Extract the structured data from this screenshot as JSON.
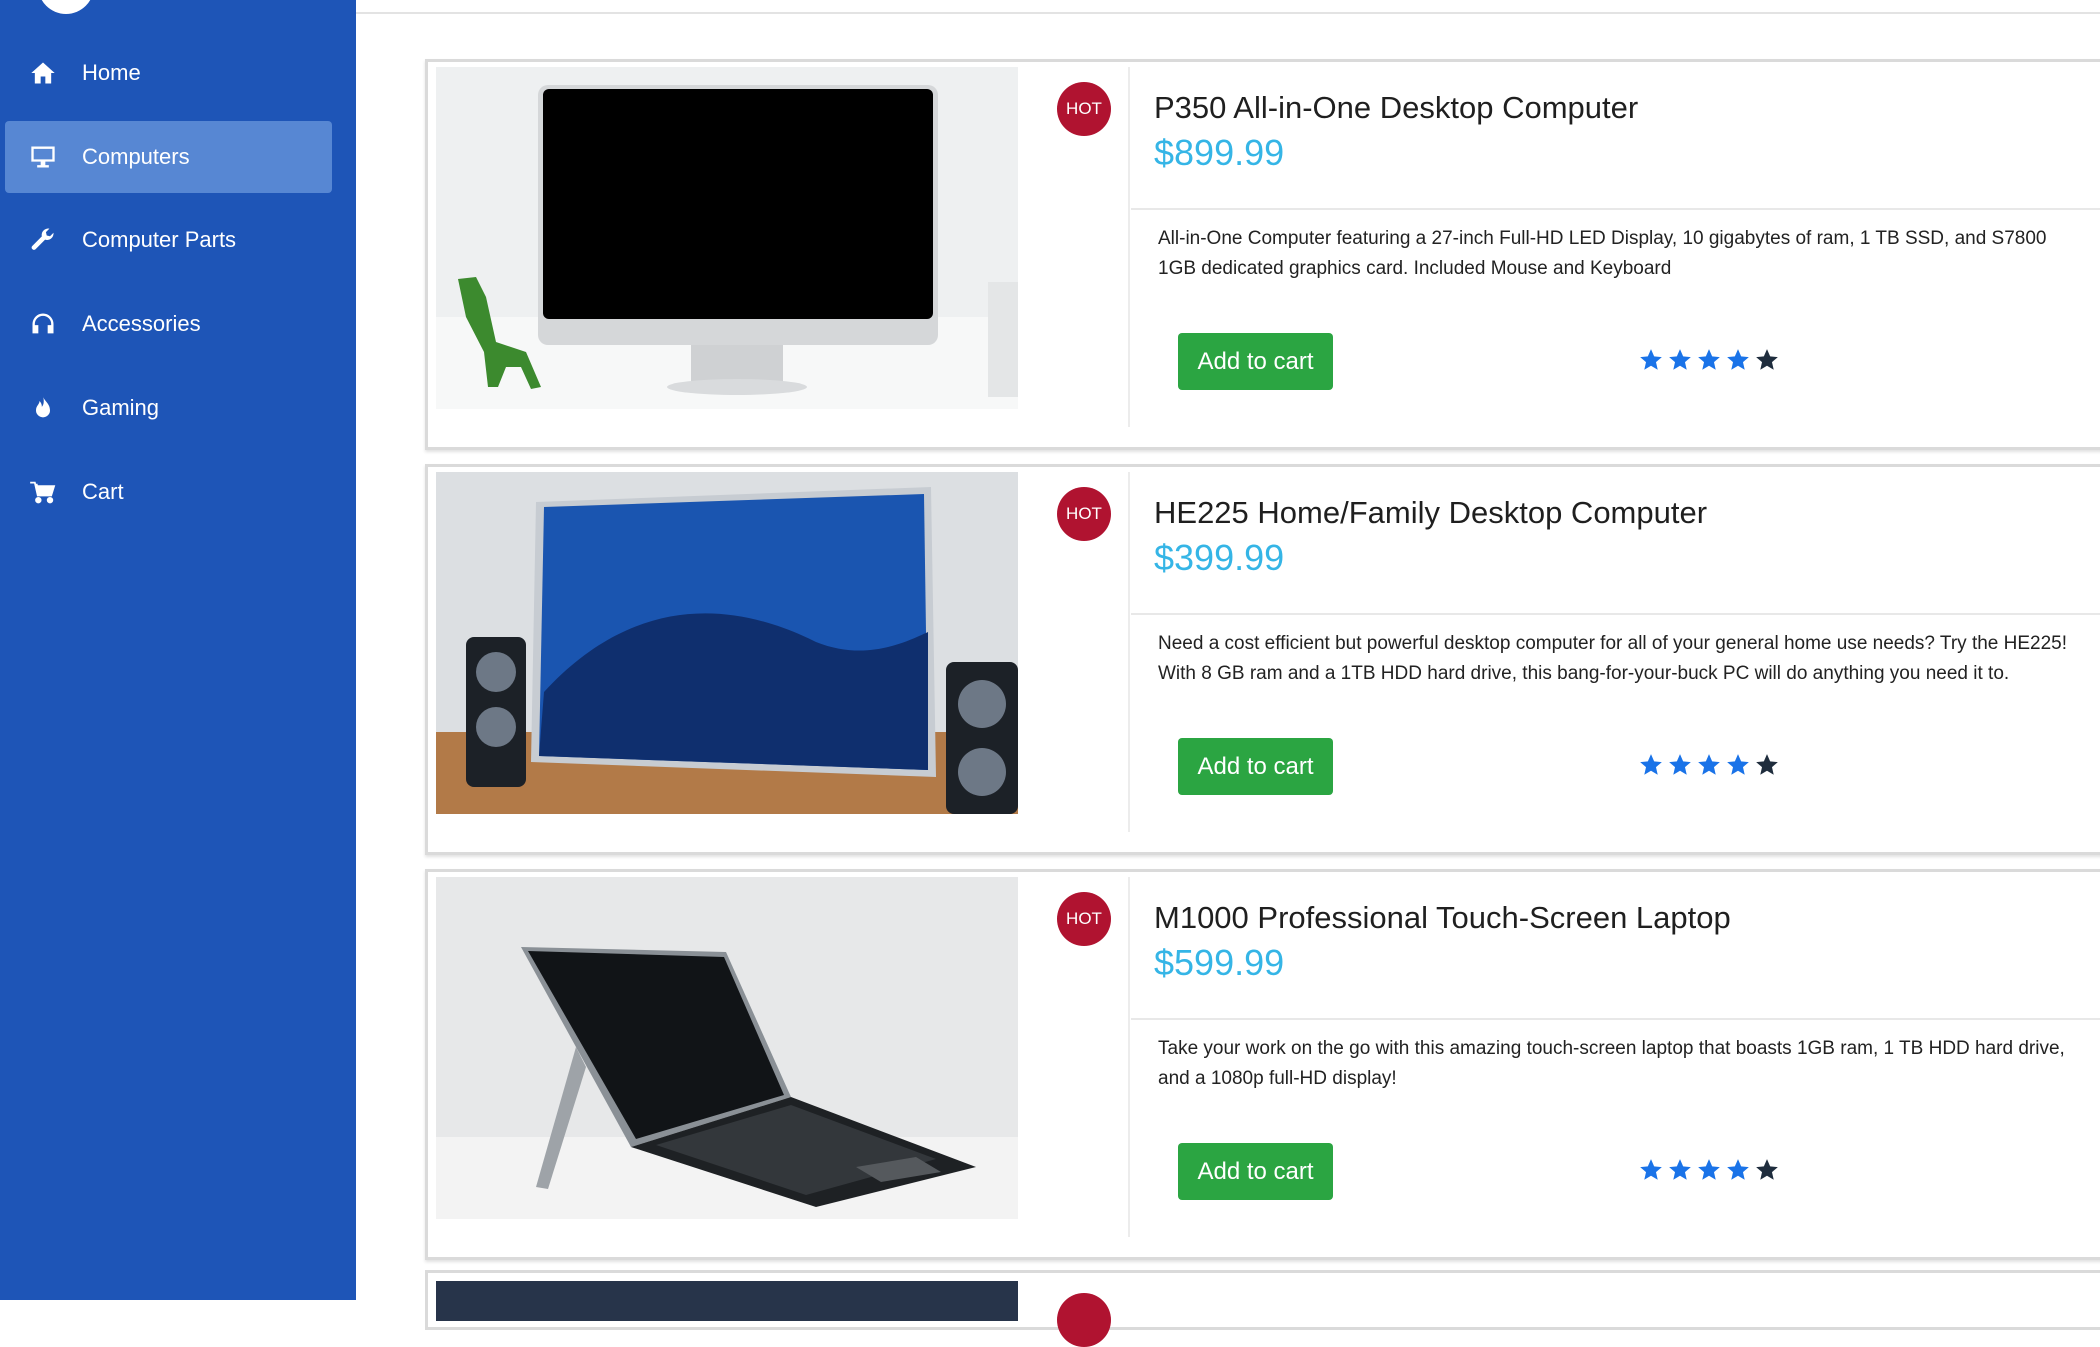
{
  "sidebar": {
    "items": [
      {
        "label": "Home",
        "icon": "home-icon",
        "active": false
      },
      {
        "label": "Computers",
        "icon": "monitor-icon",
        "active": true
      },
      {
        "label": "Computer Parts",
        "icon": "wrench-icon",
        "active": false
      },
      {
        "label": "Accessories",
        "icon": "headphones-icon",
        "active": false
      },
      {
        "label": "Gaming",
        "icon": "fire-icon",
        "active": false
      },
      {
        "label": "Cart",
        "icon": "cart-icon",
        "active": false
      }
    ]
  },
  "products": [
    {
      "badge": "HOT",
      "title": "P350 All-in-One Desktop Computer",
      "price": "$899.99",
      "description": "All-in-One Computer featuring a 27-inch Full-HD LED Display, 10 gigabytes of ram, 1 TB SSD, and S7800 1GB dedicated graphics card. Included Mouse and Keyboard",
      "button_label": "Add to cart",
      "rating": 4,
      "rating_max": 5
    },
    {
      "badge": "HOT",
      "title": "HE225 Home/Family Desktop Computer",
      "price": "$399.99",
      "description": "Need a cost efficient but powerful desktop computer for all of your general home use needs? Try the HE225! With 8 GB ram and a 1TB HDD hard drive, this bang-for-your-buck PC will do anything you need it to.",
      "button_label": "Add to cart",
      "rating": 4,
      "rating_max": 5
    },
    {
      "badge": "HOT",
      "title": "M1000 Professional Touch-Screen Laptop",
      "price": "$599.99",
      "description": "Take your work on the go with this amazing touch-screen laptop that boasts 1GB ram, 1 TB HDD hard drive, and a 1080p full-HD display!",
      "button_label": "Add to cart",
      "rating": 4,
      "rating_max": 5
    }
  ],
  "colors": {
    "sidebar_bg": "#1e55b7",
    "sidebar_active": "#5787d3",
    "price": "#35b5e6",
    "hot_badge": "#b01330",
    "add_button": "#2ba542",
    "star_filled": "#1a73e8",
    "star_empty": "#1f2d3d"
  }
}
